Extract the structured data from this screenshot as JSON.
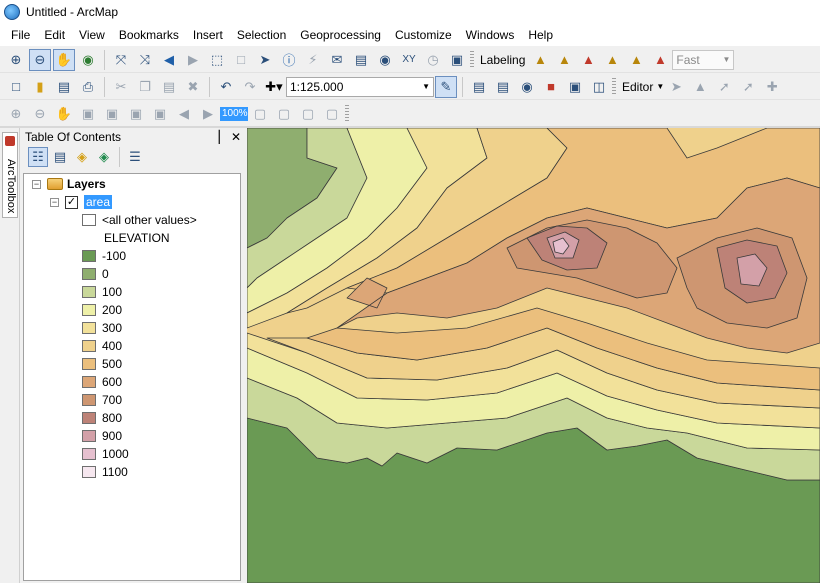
{
  "window": {
    "title": "Untitled - ArcMap"
  },
  "menu": [
    "File",
    "Edit",
    "View",
    "Bookmarks",
    "Insert",
    "Selection",
    "Geoprocessing",
    "Customize",
    "Windows",
    "Help"
  ],
  "toolbar": {
    "labeling_label": "Labeling",
    "fast_value": "Fast",
    "scale_value": "1:125.000",
    "editor_label": "Editor",
    "zoom_percent": "100%"
  },
  "arctoolbox": {
    "label": "ArcToolbox"
  },
  "toc": {
    "title": "Table Of Contents",
    "pin": "▕",
    "close": "✕",
    "root_label": "Layers",
    "layer_label": "area",
    "other_values": "<all other values>",
    "field_label": "ELEVATION",
    "classes": [
      {
        "label": "-100",
        "color": "#6a9a54"
      },
      {
        "label": "0",
        "color": "#8fae6f"
      },
      {
        "label": "100",
        "color": "#c9d89a"
      },
      {
        "label": "200",
        "color": "#eef0a8"
      },
      {
        "label": "300",
        "color": "#f2e19a"
      },
      {
        "label": "400",
        "color": "#efd18c"
      },
      {
        "label": "500",
        "color": "#ebbf7d"
      },
      {
        "label": "600",
        "color": "#dca677"
      },
      {
        "label": "700",
        "color": "#ce9671"
      },
      {
        "label": "800",
        "color": "#bd8277"
      },
      {
        "label": "900",
        "color": "#d3a0a8"
      },
      {
        "label": "1000",
        "color": "#e6c0cf"
      },
      {
        "label": "1100",
        "color": "#f6e7ef"
      }
    ]
  }
}
